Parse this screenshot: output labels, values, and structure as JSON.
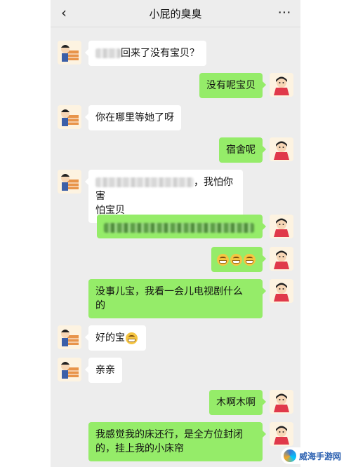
{
  "header": {
    "back_glyph": "‹",
    "title": "小屁的臭臭",
    "more_glyph": "···"
  },
  "messages": [
    {
      "side": "in",
      "text": "回来了没有宝贝？",
      "blurred_prefix": true
    },
    {
      "side": "out",
      "text": "没有呢宝贝"
    },
    {
      "side": "in",
      "text": "你在哪里等她了呀"
    },
    {
      "side": "out",
      "text": "宿舍呢"
    },
    {
      "side": "in",
      "text_line1": "，我怕你害",
      "text_line2": "怕宝贝",
      "blurred_prefix": true
    },
    {
      "side": "out",
      "blurred": true
    },
    {
      "side": "out",
      "emoji_count": 3,
      "emoji_name": "grimacing-face-emoji"
    },
    {
      "side": "out",
      "text_line1": "没事儿宝，我看一会儿电视剧什么",
      "text_line2": "的"
    },
    {
      "side": "in",
      "text": "好的宝",
      "emoji_name": "grimacing-face-emoji"
    },
    {
      "side": "in",
      "text": "亲亲"
    },
    {
      "side": "out",
      "text": "木啊木啊"
    },
    {
      "side": "out",
      "text_line1": "我感觉我的床还行，是全方位封闭",
      "text_line2": "的，挂上我的小床帘"
    }
  ],
  "avatars": {
    "left_icon": "cartoon-boy-with-bricks",
    "right_icon": "cartoon-girl-red-dress"
  },
  "watermark": {
    "text": "威海手游网"
  },
  "colors": {
    "outgoing_bubble": "#95ec69",
    "incoming_bubble": "#ffffff",
    "chat_background": "#ededed"
  }
}
